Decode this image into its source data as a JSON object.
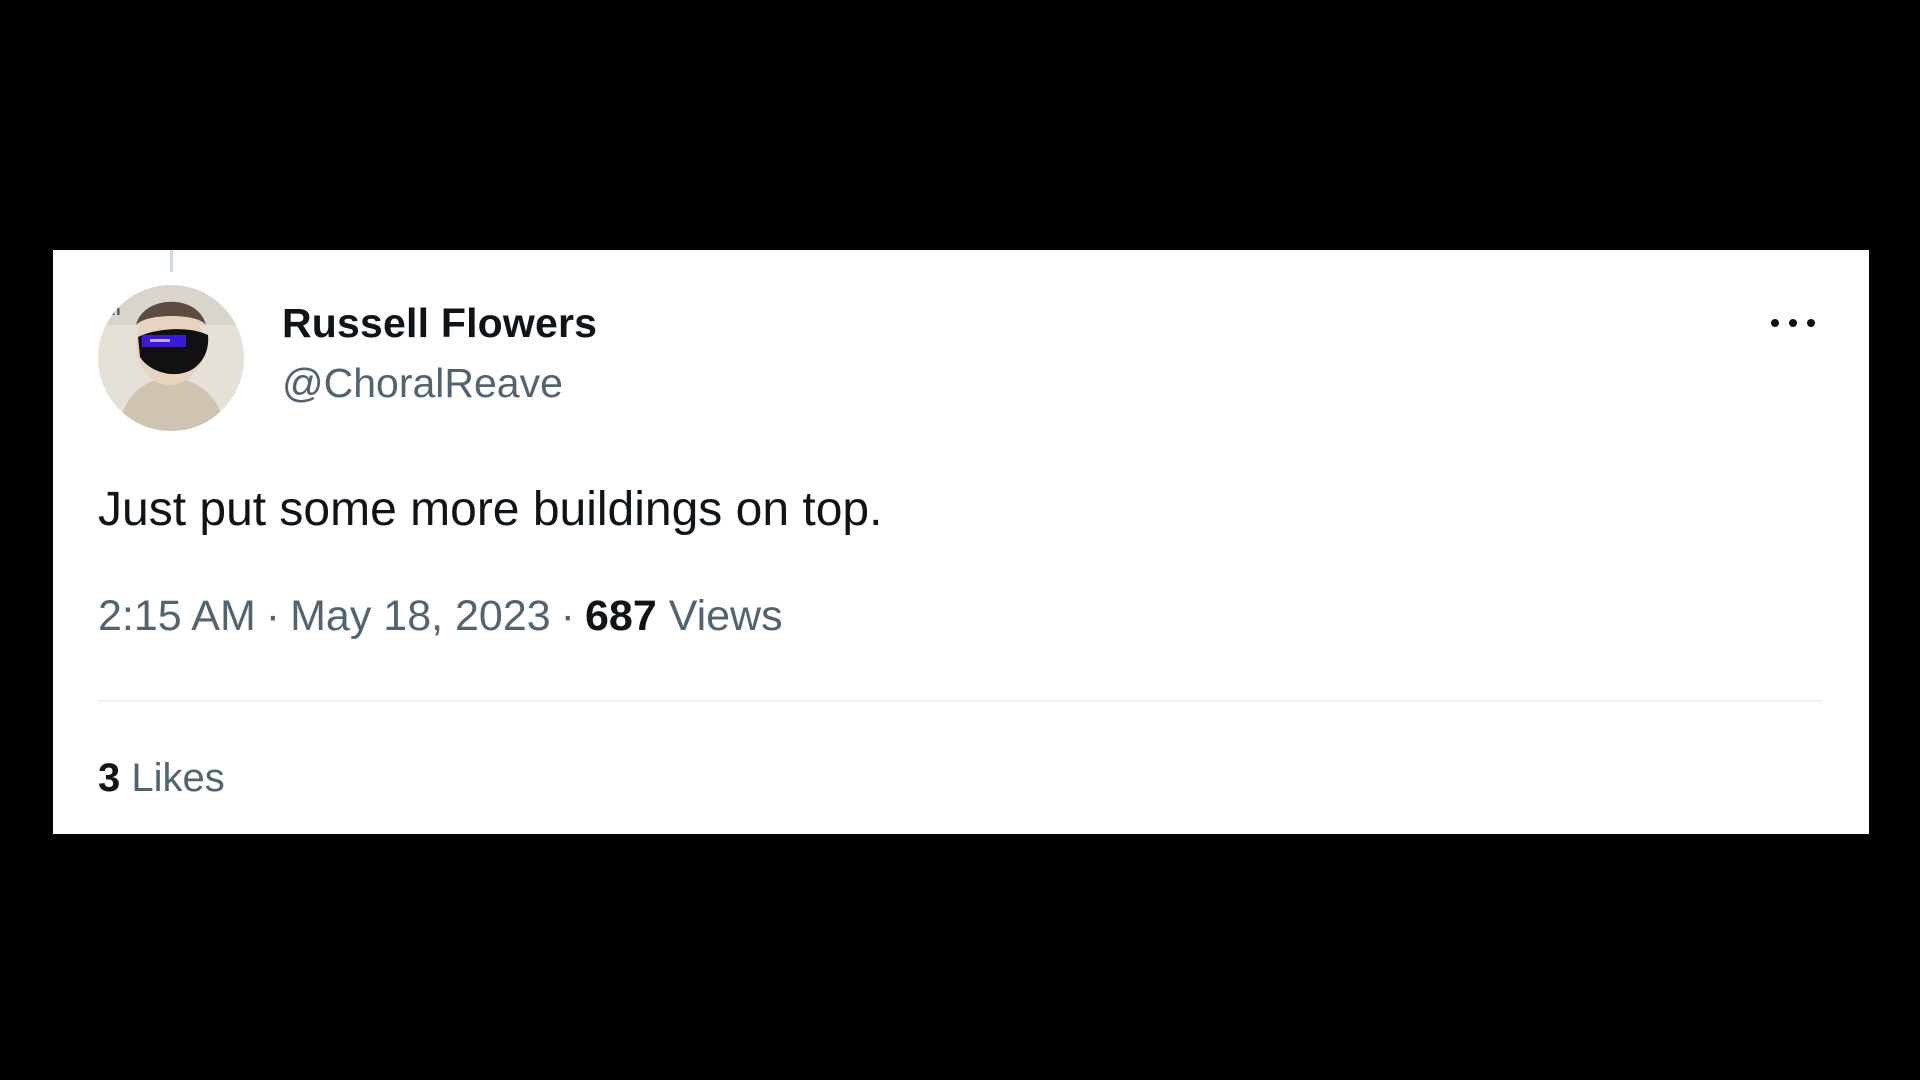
{
  "tweet": {
    "author": {
      "name": "Russell Flowers",
      "handle": "@ChoralReave"
    },
    "text": "Just put some more buildings on top.",
    "timestamp": {
      "time": "2:15 AM",
      "separator": "·",
      "date": "May 18, 2023"
    },
    "views": {
      "count": "687",
      "label": "Views"
    },
    "likes": {
      "count": "3",
      "label": "Likes"
    },
    "icons": {
      "more": "more-horizontal-icon",
      "avatar": "avatar-image"
    },
    "colors": {
      "background": "#000000",
      "card": "#ffffff",
      "primary_text": "#0f1419",
      "secondary_text": "#536471",
      "divider": "#eff3f4"
    }
  }
}
